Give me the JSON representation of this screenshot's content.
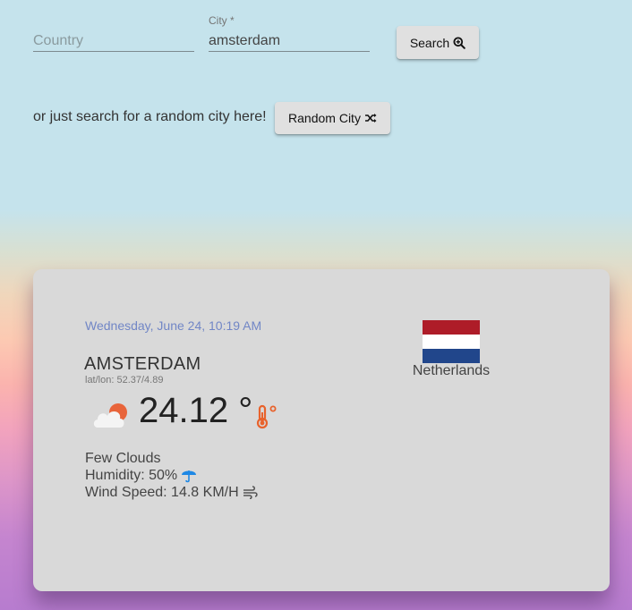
{
  "search": {
    "country_placeholder": "Country",
    "country_value": "",
    "city_label": "City *",
    "city_value": "amsterdam",
    "search_label": "Search",
    "search_icon": "zoom-in-icon",
    "random_text": "or just search for a random city here!",
    "random_label": "Random City",
    "random_icon": "shuffle-icon"
  },
  "weather": {
    "date": "Wednesday, June 24, 10:19 AM",
    "city": "AMSTERDAM",
    "latlon": "lat/lon: 52.37/4.89",
    "temperature": "24.12 °",
    "description": "Few Clouds",
    "humidity": "Humidity: 50%",
    "wind": "Wind Speed: 14.8 KM/H",
    "country": "Netherlands",
    "icons": {
      "weather": "sun-behind-cloud-icon",
      "temperature": "thermometer-celsius-icon",
      "humidity": "umbrella-icon",
      "wind": "wind-icon",
      "flag": "netherlands-flag"
    },
    "flag_colors": [
      "#ae1c28",
      "#ffffff",
      "#21468b"
    ]
  },
  "colors": {
    "date_accent": "#7186c6",
    "thermometer": "#e8622c",
    "umbrella": "#1e88e5",
    "card_background": "#d9d9d9"
  }
}
